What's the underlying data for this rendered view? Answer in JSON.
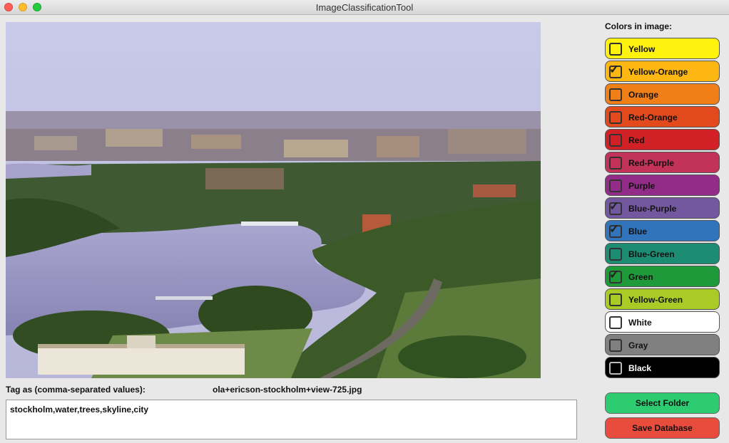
{
  "window": {
    "title": "ImageClassificationTool"
  },
  "image": {
    "filename": "ola+ericson-stockholm+view-725.jpg"
  },
  "tag": {
    "label": "Tag as (comma-separated values):",
    "value": "stockholm,water,trees,skyline,city"
  },
  "colors": {
    "heading": "Colors in image:",
    "items": [
      {
        "label": "Yellow",
        "color": "#fff20f",
        "checked": false,
        "text_color": "#111111"
      },
      {
        "label": "Yellow-Orange",
        "color": "#fcb713",
        "checked": true,
        "text_color": "#111111"
      },
      {
        "label": "Orange",
        "color": "#f07f18",
        "checked": false,
        "text_color": "#111111"
      },
      {
        "label": "Red-Orange",
        "color": "#e2491c",
        "checked": false,
        "text_color": "#111111"
      },
      {
        "label": "Red",
        "color": "#d12126",
        "checked": false,
        "text_color": "#111111"
      },
      {
        "label": "Red-Purple",
        "color": "#c23259",
        "checked": false,
        "text_color": "#111111"
      },
      {
        "label": "Purple",
        "color": "#932c88",
        "checked": false,
        "text_color": "#111111"
      },
      {
        "label": "Blue-Purple",
        "color": "#74589f",
        "checked": true,
        "text_color": "#111111"
      },
      {
        "label": "Blue",
        "color": "#3174bb",
        "checked": true,
        "text_color": "#111111"
      },
      {
        "label": "Blue-Green",
        "color": "#1c8c72",
        "checked": false,
        "text_color": "#111111"
      },
      {
        "label": "Green",
        "color": "#1f9a3a",
        "checked": true,
        "text_color": "#111111"
      },
      {
        "label": "Yellow-Green",
        "color": "#a8cb25",
        "checked": false,
        "text_color": "#111111"
      },
      {
        "label": "White",
        "color": "#ffffff",
        "checked": false,
        "text_color": "#111111"
      },
      {
        "label": "Gray",
        "color": "#808080",
        "checked": false,
        "text_color": "#111111"
      },
      {
        "label": "Black",
        "color": "#000000",
        "checked": false,
        "text_color": "#ffffff"
      }
    ]
  },
  "buttons": {
    "select_folder": "Select Folder",
    "save_database": "Save Database"
  }
}
